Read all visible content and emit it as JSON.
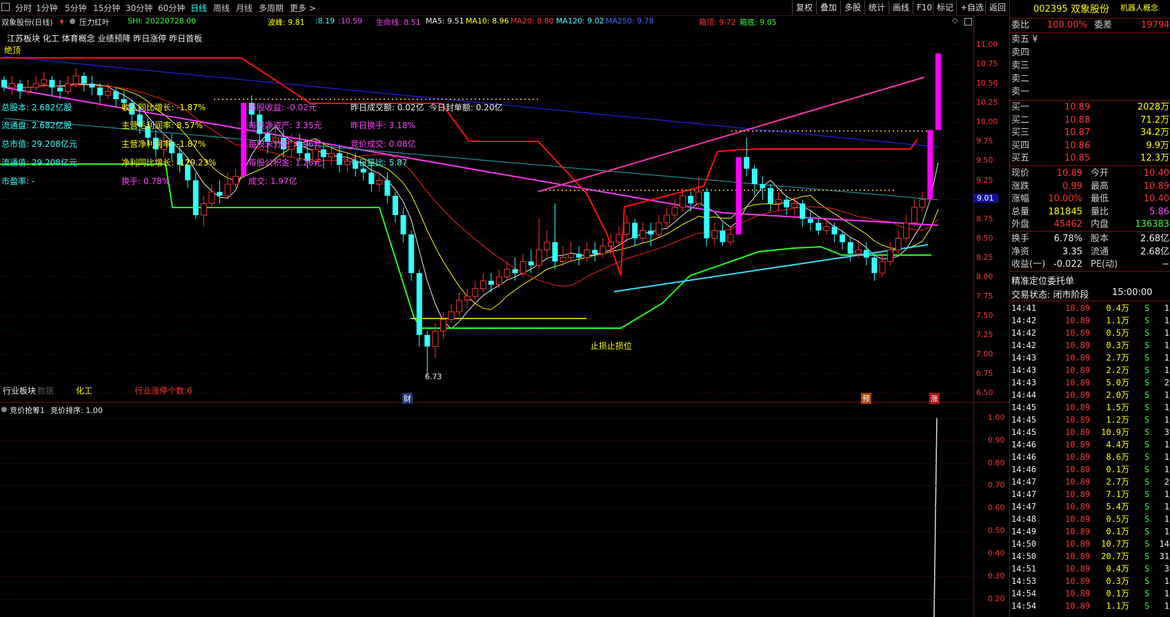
{
  "periods": [
    "分时",
    "1分钟",
    "5分钟",
    "15分钟",
    "30分钟",
    "60分钟",
    "日线",
    "周线",
    "月线",
    "多周期",
    "更多 >"
  ],
  "active_period": "日线",
  "toolbar_buttons": [
    "复权",
    "叠加",
    "多股",
    "统计",
    "画线",
    "F10",
    "标记",
    "+自选",
    "返回"
  ],
  "chart_title": "双象股份(日线)",
  "pressure_label": "压力红叶",
  "shi_label": "SHI: 20220728.00",
  "indicators": {
    "bofeng": "波峰: 9.81",
    "bofeng2": ":8.19",
    "bofeng3": ":10.59",
    "shengming": "生命线: 8.51",
    "ma5": "MA5: 9.51",
    "ma10": "MA10: 8.96",
    "ma20": "MA20: 8.80",
    "ma120": "MA120: 9.02",
    "ma250": "MA250: 9.78",
    "xiangding": "箱顶: 9.72",
    "xiangdi": "箱底: 9.05"
  },
  "concept_line": "江苏板块 化工 体育概念 业绩预降 昨日涨停 昨日首板",
  "signal_tag": "绝顶",
  "fundamentals": {
    "col1": [
      "总股本: 2.682亿股",
      "流通盘: 2.682亿股",
      "总市值: 29.208亿元",
      "流通值: 29.208亿元",
      "市盈率: -"
    ],
    "col2": [
      "收入同比增长: -1.87%",
      "主营毛利润率: 8.57%",
      "主营净利润率: -1.87%",
      "净利同比增长: -129.23%",
      "换手: 0.78%"
    ],
    "col3": [
      "每股收益: -0.02元",
      "每股净资产: 3.35元",
      "每股未分配: 0.96元",
      "每股公积金: 1.26元",
      "成交: 1.97亿"
    ],
    "col4": [
      "昨日成交额: 0.02亿",
      "昨日换手: 3.18%",
      "竞价成交: 0.08亿",
      "今日量比: 5.87"
    ],
    "today_seal": "今日封单额: 0.20亿"
  },
  "stop_label": "止损止损位",
  "low_price": "6.73",
  "bottom_labels": {
    "sector": "行业板块",
    "sector_sub": "数据",
    "industry": "化工",
    "limit_count": "行业涨停个数:6"
  },
  "markers": {
    "cai": "财",
    "yu": "预",
    "zhang": "涨"
  },
  "price_axis": [
    "11.00",
    "10.75",
    "10.50",
    "10.25",
    "10.00",
    "9.75",
    "9.50",
    "9.25",
    "9.00",
    "8.75",
    "8.50",
    "8.25",
    "8.00",
    "7.75",
    "7.50",
    "7.25",
    "7.00",
    "6.75",
    "6.50"
  ],
  "current_price_tag": "9.01",
  "sub_chart": {
    "title": "竞价抢筹1",
    "sort_label": "竞价排序: 1.00",
    "axis": [
      "1.00",
      "0.90",
      "0.80",
      "0.70",
      "0.60",
      "0.50",
      "0.40",
      "0.30",
      "0.20"
    ]
  },
  "stock": {
    "code": "002395",
    "name": "双象股份",
    "concept": "机器人概念"
  },
  "weibi": {
    "label1": "委比",
    "val1": "100.00%",
    "label2": "委差",
    "val2": "19794"
  },
  "sell_levels": [
    "卖五 ¥",
    "卖四",
    "卖三",
    "卖二",
    "卖一"
  ],
  "buy_levels": [
    {
      "label": "买一",
      "price": "10.89",
      "vol": "2028万"
    },
    {
      "label": "买二",
      "price": "10.88",
      "vol": "71.2万"
    },
    {
      "label": "买三",
      "price": "10.87",
      "vol": "34.2万"
    },
    {
      "label": "买四",
      "price": "10.86",
      "vol": "9.9万"
    },
    {
      "label": "买五",
      "price": "10.85",
      "vol": "12.3万"
    }
  ],
  "quote": [
    {
      "l1": "现价",
      "v1": "10.89",
      "l2": "今开",
      "v2": "10.40"
    },
    {
      "l1": "涨跌",
      "v1": "0.99",
      "l2": "最高",
      "v2": "10.89"
    },
    {
      "l1": "涨幅",
      "v1": "10.00%",
      "l2": "最低",
      "v2": "10.40"
    },
    {
      "l1": "总量",
      "v1": "181845",
      "l2": "量比",
      "v2": "5.86"
    },
    {
      "l1": "外盘",
      "v1": "45462",
      "l2": "内盘",
      "v2": "136383"
    }
  ],
  "stats": [
    {
      "l1": "换手",
      "v1": "6.78%",
      "l2": "股本",
      "v2": "2.68亿"
    },
    {
      "l1": "净资",
      "v1": "3.35",
      "l2": "流通",
      "v2": "2.68亿"
    },
    {
      "l1": "收益(一)",
      "v1": "-0.022",
      "l2": "PE(动)",
      "v2": "−"
    }
  ],
  "order_title": "精准定位委托单",
  "trade_state": {
    "label": "交易状态: 闭市阶段",
    "time": "15:00:00"
  },
  "ticks": [
    {
      "t": "14:41",
      "p": "10.89",
      "v": "0.4万",
      "s": "S",
      "n": "1"
    },
    {
      "t": "14:42",
      "p": "10.89",
      "v": "1.1万",
      "s": "S",
      "n": "1"
    },
    {
      "t": "14:42",
      "p": "10.89",
      "v": "0.5万",
      "s": "S",
      "n": "1"
    },
    {
      "t": "14:42",
      "p": "10.89",
      "v": "0.3万",
      "s": "S",
      "n": "1"
    },
    {
      "t": "14:43",
      "p": "10.89",
      "v": "2.7万",
      "s": "S",
      "n": "1"
    },
    {
      "t": "14:43",
      "p": "10.89",
      "v": "2.2万",
      "s": "S",
      "n": "1"
    },
    {
      "t": "14:43",
      "p": "10.89",
      "v": "5.0万",
      "s": "S",
      "n": "2"
    },
    {
      "t": "14:44",
      "p": "10.89",
      "v": "2.0万",
      "s": "S",
      "n": "1"
    },
    {
      "t": "14:45",
      "p": "10.89",
      "v": "1.5万",
      "s": "S",
      "n": "1"
    },
    {
      "t": "14:45",
      "p": "10.89",
      "v": "1.2万",
      "s": "S",
      "n": "1"
    },
    {
      "t": "14:45",
      "p": "10.89",
      "v": "10.9万",
      "s": "S",
      "n": "3"
    },
    {
      "t": "14:46",
      "p": "10.89",
      "v": "4.4万",
      "s": "S",
      "n": "1"
    },
    {
      "t": "14:46",
      "p": "10.89",
      "v": "8.6万",
      "s": "S",
      "n": "1"
    },
    {
      "t": "14:46",
      "p": "10.89",
      "v": "0.1万",
      "s": "S",
      "n": "1"
    },
    {
      "t": "14:47",
      "p": "10.89",
      "v": "2.7万",
      "s": "S",
      "n": "2"
    },
    {
      "t": "14:47",
      "p": "10.89",
      "v": "7.1万",
      "s": "S",
      "n": "1"
    },
    {
      "t": "14:47",
      "p": "10.89",
      "v": "5.4万",
      "s": "S",
      "n": "1"
    },
    {
      "t": "14:48",
      "p": "10.89",
      "v": "0.5万",
      "s": "S",
      "n": "1"
    },
    {
      "t": "14:49",
      "p": "10.89",
      "v": "0.1万",
      "s": "S",
      "n": "1"
    },
    {
      "t": "14:50",
      "p": "10.89",
      "v": "10.7万",
      "s": "S",
      "n": "14"
    },
    {
      "t": "14:50",
      "p": "10.89",
      "v": "20.7万",
      "s": "S",
      "n": "31"
    },
    {
      "t": "14:51",
      "p": "10.89",
      "v": "0.4万",
      "s": "S",
      "n": "3"
    },
    {
      "t": "14:53",
      "p": "10.89",
      "v": "0.3万",
      "s": "S",
      "n": "1"
    },
    {
      "t": "14:54",
      "p": "10.89",
      "v": "0.1万",
      "s": "S",
      "n": "1"
    },
    {
      "t": "14:54",
      "p": "10.89",
      "v": "1.1万",
      "s": "S",
      "n": "1"
    }
  ],
  "colors": {
    "up": "#ff3333",
    "down": "#33ffff",
    "bg": "#000000",
    "limit": "#ff00ff"
  },
  "chart_data": {
    "type": "candlestick",
    "candles": [
      [
        10.55,
        10.45,
        10.6,
        10.4
      ],
      [
        10.45,
        10.5,
        10.6,
        10.35
      ],
      [
        10.5,
        10.4,
        10.55,
        10.3
      ],
      [
        10.4,
        10.45,
        10.55,
        10.35
      ],
      [
        10.45,
        10.5,
        10.6,
        10.4
      ],
      [
        10.5,
        10.55,
        10.65,
        10.45
      ],
      [
        10.55,
        10.45,
        10.6,
        10.35
      ],
      [
        10.45,
        10.4,
        10.55,
        10.3
      ],
      [
        10.4,
        10.5,
        10.6,
        10.35
      ],
      [
        10.5,
        10.6,
        10.7,
        10.45
      ],
      [
        10.6,
        10.5,
        10.65,
        10.4
      ],
      [
        10.5,
        10.45,
        10.6,
        10.35
      ],
      [
        10.45,
        10.35,
        10.5,
        10.25
      ],
      [
        10.35,
        10.4,
        10.5,
        10.3
      ],
      [
        10.4,
        10.3,
        10.45,
        10.2
      ],
      [
        10.3,
        10.25,
        10.4,
        10.15
      ],
      [
        10.25,
        10.1,
        10.3,
        10.0
      ],
      [
        10.1,
        9.95,
        10.2,
        9.85
      ],
      [
        9.95,
        9.8,
        10.05,
        9.7
      ],
      [
        9.8,
        9.65,
        9.9,
        9.55
      ],
      [
        9.65,
        9.75,
        9.85,
        9.55
      ],
      [
        9.75,
        9.6,
        9.85,
        9.5
      ],
      [
        9.6,
        9.45,
        9.7,
        9.35
      ],
      [
        9.45,
        9.25,
        9.55,
        9.15
      ],
      [
        9.25,
        8.8,
        9.35,
        8.75
      ],
      [
        8.8,
        8.95,
        9.05,
        8.65
      ],
      [
        8.95,
        9.1,
        9.2,
        8.9
      ],
      [
        9.1,
        9.05,
        9.25,
        8.95
      ],
      [
        9.05,
        9.2,
        9.35,
        9.0
      ],
      [
        9.2,
        9.3,
        9.4,
        9.15
      ],
      [
        9.3,
        10.25,
        10.25,
        9.3
      ],
      [
        10.25,
        10.1,
        10.35,
        9.95
      ],
      [
        10.1,
        9.85,
        10.15,
        9.7
      ],
      [
        9.85,
        9.75,
        9.95,
        9.6
      ],
      [
        9.75,
        9.8,
        9.95,
        9.65
      ],
      [
        9.8,
        9.65,
        9.9,
        9.55
      ],
      [
        9.65,
        9.75,
        9.85,
        9.55
      ],
      [
        9.75,
        9.6,
        9.85,
        9.5
      ],
      [
        9.6,
        9.5,
        9.75,
        9.4
      ],
      [
        9.5,
        9.65,
        9.8,
        9.45
      ],
      [
        9.65,
        9.55,
        9.75,
        9.4
      ],
      [
        9.55,
        9.6,
        9.7,
        9.45
      ],
      [
        9.6,
        9.45,
        9.7,
        9.35
      ],
      [
        9.45,
        9.5,
        9.6,
        9.35
      ],
      [
        9.5,
        9.4,
        9.6,
        9.3
      ],
      [
        9.4,
        9.35,
        9.5,
        9.25
      ],
      [
        9.35,
        9.2,
        9.45,
        9.1
      ],
      [
        9.2,
        9.25,
        9.35,
        9.1
      ],
      [
        9.25,
        9.05,
        9.35,
        8.95
      ],
      [
        9.05,
        8.8,
        9.1,
        8.7
      ],
      [
        8.8,
        8.55,
        8.9,
        8.45
      ],
      [
        8.55,
        8.05,
        8.6,
        7.95
      ],
      [
        8.05,
        7.25,
        8.1,
        7.1
      ],
      [
        7.25,
        7.1,
        7.3,
        6.73
      ],
      [
        7.1,
        7.3,
        7.4,
        6.95
      ],
      [
        7.3,
        7.45,
        7.55,
        7.2
      ],
      [
        7.45,
        7.55,
        7.65,
        7.4
      ],
      [
        7.55,
        7.7,
        7.8,
        7.5
      ],
      [
        7.7,
        7.75,
        7.85,
        7.6
      ],
      [
        7.75,
        7.85,
        7.95,
        7.7
      ],
      [
        7.85,
        7.95,
        8.05,
        7.8
      ],
      [
        7.95,
        7.9,
        8.05,
        7.8
      ],
      [
        7.9,
        8.0,
        8.1,
        7.85
      ],
      [
        8.0,
        8.1,
        8.2,
        7.95
      ],
      [
        8.1,
        8.05,
        8.25,
        7.95
      ],
      [
        8.05,
        8.2,
        8.3,
        8.0
      ],
      [
        8.2,
        8.15,
        8.35,
        8.05
      ],
      [
        8.15,
        8.35,
        8.75,
        8.1
      ],
      [
        8.35,
        8.45,
        8.6,
        8.25
      ],
      [
        8.45,
        8.2,
        8.95,
        8.1
      ],
      [
        8.2,
        8.25,
        8.4,
        8.15
      ],
      [
        8.25,
        8.3,
        8.45,
        8.2
      ],
      [
        8.3,
        8.25,
        8.4,
        8.15
      ],
      [
        8.25,
        8.35,
        8.45,
        8.2
      ],
      [
        8.35,
        8.3,
        8.45,
        8.2
      ],
      [
        8.3,
        8.4,
        8.5,
        8.25
      ],
      [
        8.4,
        8.45,
        8.55,
        8.3
      ],
      [
        8.45,
        8.55,
        8.65,
        8.4
      ],
      [
        8.55,
        8.7,
        8.8,
        8.45
      ],
      [
        8.7,
        8.5,
        8.75,
        8.4
      ],
      [
        8.5,
        8.6,
        8.7,
        8.45
      ],
      [
        8.6,
        8.55,
        8.7,
        8.4
      ],
      [
        8.55,
        8.7,
        8.8,
        8.5
      ],
      [
        8.7,
        8.8,
        8.9,
        8.65
      ],
      [
        8.8,
        8.9,
        9.0,
        8.75
      ],
      [
        8.9,
        9.05,
        9.15,
        8.85
      ],
      [
        9.05,
        8.95,
        9.1,
        8.85
      ],
      [
        8.95,
        9.1,
        9.3,
        8.9
      ],
      [
        9.1,
        8.5,
        9.15,
        8.4
      ],
      [
        8.5,
        8.6,
        8.7,
        8.4
      ],
      [
        8.6,
        8.45,
        8.7,
        8.4
      ],
      [
        8.45,
        8.55,
        8.65,
        8.4
      ],
      [
        8.55,
        9.55,
        9.55,
        8.55
      ],
      [
        9.55,
        9.4,
        9.8,
        9.3
      ],
      [
        9.4,
        9.2,
        9.45,
        9.05
      ],
      [
        9.2,
        9.15,
        9.3,
        9.0
      ],
      [
        9.15,
        8.95,
        9.2,
        8.85
      ],
      [
        8.95,
        9.0,
        9.1,
        8.85
      ],
      [
        9.0,
        8.9,
        9.05,
        8.8
      ],
      [
        8.9,
        8.95,
        9.05,
        8.8
      ],
      [
        8.95,
        8.75,
        9.0,
        8.65
      ],
      [
        8.75,
        8.7,
        8.85,
        8.6
      ],
      [
        8.7,
        8.6,
        8.75,
        8.55
      ],
      [
        8.6,
        8.65,
        8.75,
        8.55
      ],
      [
        8.65,
        8.55,
        8.7,
        8.45
      ],
      [
        8.55,
        8.45,
        8.6,
        8.35
      ],
      [
        8.45,
        8.3,
        8.5,
        8.2
      ],
      [
        8.3,
        8.35,
        8.45,
        8.25
      ],
      [
        8.35,
        8.25,
        8.45,
        8.15
      ],
      [
        8.25,
        8.05,
        8.3,
        7.95
      ],
      [
        8.05,
        8.2,
        8.3,
        8.0
      ],
      [
        8.2,
        8.35,
        8.45,
        8.15
      ],
      [
        8.35,
        8.5,
        8.6,
        8.3
      ],
      [
        8.5,
        8.7,
        8.8,
        8.45
      ],
      [
        8.7,
        8.9,
        9.0,
        8.65
      ],
      [
        8.9,
        9.0,
        9.1,
        8.85
      ],
      [
        9.0,
        9.9,
        9.9,
        9.0
      ],
      [
        9.9,
        10.89,
        10.89,
        9.9
      ]
    ],
    "price_min": 6.5,
    "price_max": 11.1
  }
}
